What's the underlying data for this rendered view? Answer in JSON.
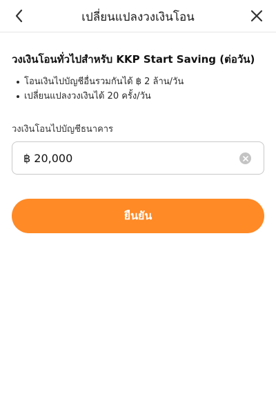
{
  "header": {
    "title": "เปลี่ยนแปลงวงเงินโอน",
    "back_icon": "chevron-left-icon",
    "close_icon": "close-icon"
  },
  "limits": {
    "heading": "วงเงินโอนทั่วไปสำหรับ KKP Start Saving (ต่อวัน)",
    "bullets": [
      "โอนเงินไปบัญชีอื่นรวมกันได้ ฿ 2 ล้าน/วัน",
      "เปลี่ยนแปลงวงเงินได้ 20 ครั้ง/วัน"
    ]
  },
  "form": {
    "field_label": "วงเงินโอนไปบัญชีธนาคาร",
    "amount_value": "฿ 20,000",
    "clear_icon": "clear-icon"
  },
  "actions": {
    "confirm_label": "ยืนยัน"
  },
  "colors": {
    "accent": "#ff8a26",
    "divider": "#e6e6e6",
    "input_border": "#c9c9c9",
    "clear_bg": "#c4c4c4"
  }
}
